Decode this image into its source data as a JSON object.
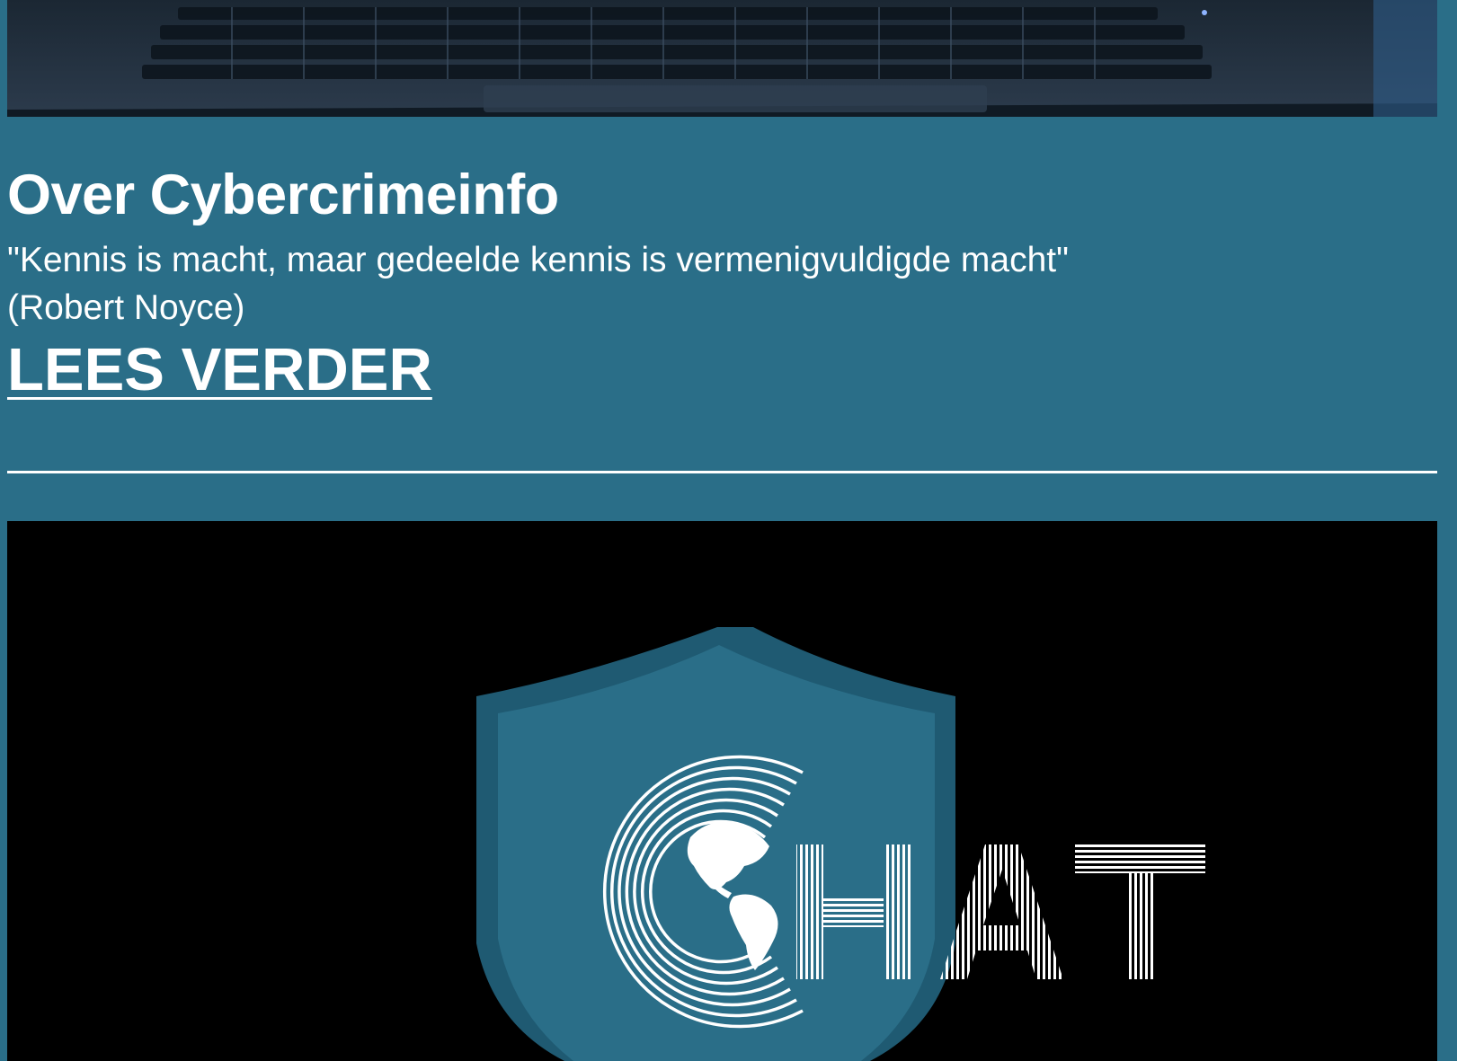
{
  "about": {
    "title": "Over Cybercrimeinfo",
    "quote": "\"Kennis is macht, maar gedeelde kennis is vermenigvuldigde macht\"",
    "author": "(Robert Noyce)",
    "read_more": "LEES VERDER"
  },
  "banner": {
    "logo_text": "HAT"
  },
  "colors": {
    "page_background": "#2a6e88",
    "shield_outer": "#1f5a72",
    "shield_inner": "#2a6e88",
    "banner_background": "#000000",
    "text": "#ffffff"
  }
}
